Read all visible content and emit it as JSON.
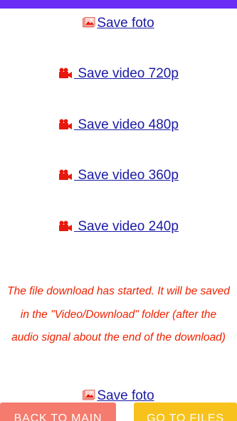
{
  "links": [
    {
      "label": "Save foto",
      "icon": "image-icon"
    },
    {
      "label": " Save video 720p",
      "icon": "video-camera-icon"
    },
    {
      "label": " Save video 480p",
      "icon": "video-camera-icon"
    },
    {
      "label": " Save video 360p",
      "icon": "video-camera-icon"
    },
    {
      "label": " Save video 240p",
      "icon": "video-camera-icon"
    },
    {
      "label": "Save foto",
      "icon": "image-icon"
    }
  ],
  "notice": "The file download has started. It will be saved in the \"Video/Download\" folder (after the audio signal about the end of the download)",
  "buttons": {
    "back_label": "BACK TO MAIN",
    "files_label": "GO TO FILES"
  },
  "colors": {
    "status_bar": "#6a2cf5",
    "link": "#1a1aa6",
    "notice": "#ee2200",
    "icon_red": "#e8180c",
    "back_button": "#f47b6d",
    "files_button": "#f8c21c"
  }
}
